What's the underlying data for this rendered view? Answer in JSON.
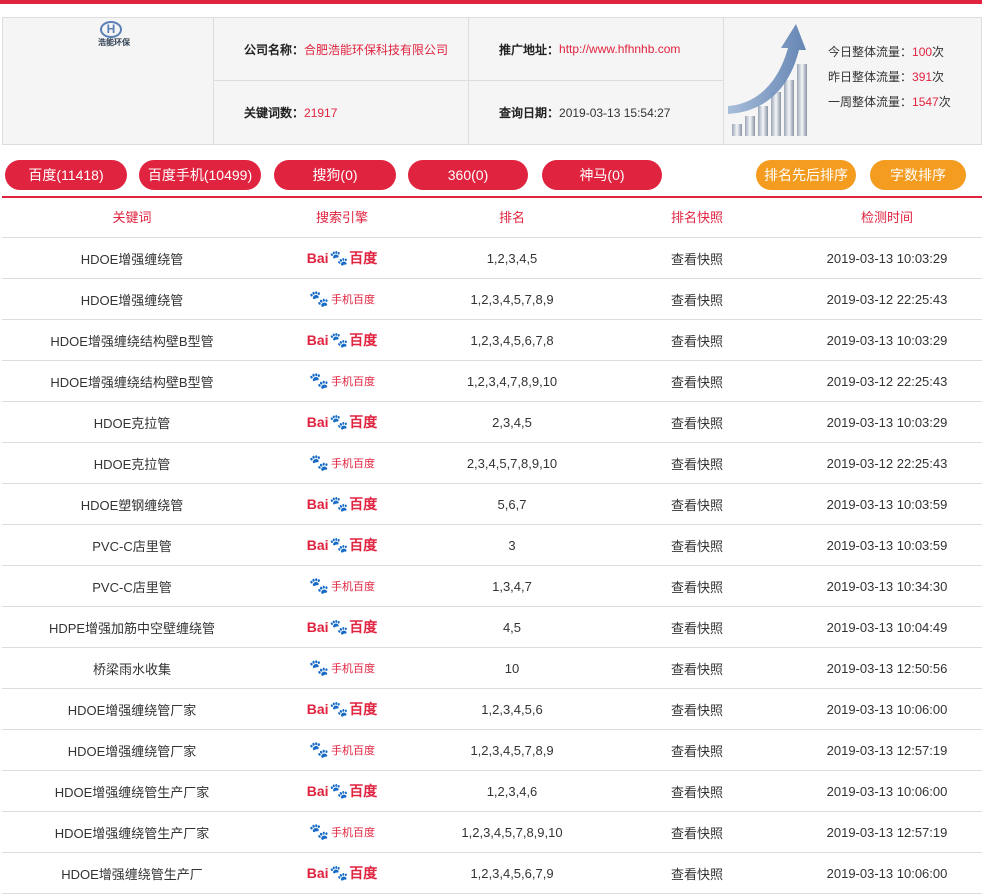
{
  "header": {
    "logo_text": "浩能环保",
    "company_label": "公司名称：",
    "company_value": "合肥浩能环保科技有限公司",
    "url_label": "推广地址：",
    "url_value": "http://www.hfhnhb.com",
    "keywords_label": "关键词数：",
    "keywords_value": "21917",
    "date_label": "查询日期：",
    "date_value": "2019-03-13 15:54:27",
    "traffic": [
      {
        "label": "今日整体流量：",
        "value": "100",
        "unit": "次"
      },
      {
        "label": "昨日整体流量：",
        "value": "391",
        "unit": "次"
      },
      {
        "label": "一周整体流量：",
        "value": "1547",
        "unit": "次"
      }
    ]
  },
  "tabs": {
    "baidu": "百度(11418)",
    "baidu_mobile": "百度手机(10499)",
    "sogou": "搜狗(0)",
    "s360": "360(0)",
    "shenma": "神马(0)",
    "sort_rank": "排名先后排序",
    "sort_chars": "字数排序"
  },
  "table": {
    "headers": [
      "关键词",
      "搜索引擎",
      "排名",
      "排名快照",
      "检测时间"
    ],
    "engine_labels": {
      "baidu_bai": "Bai",
      "baidu_du": "百度",
      "mobile": "手机百度"
    },
    "rows": [
      {
        "keyword": "HDOE增强缠绕管",
        "engine": "baidu",
        "rank": "1,2,3,4,5",
        "snapshot": "查看快照",
        "time": "2019-03-13 10:03:29"
      },
      {
        "keyword": "HDOE增强缠绕管",
        "engine": "mobile",
        "rank": "1,2,3,4,5,7,8,9",
        "snapshot": "查看快照",
        "time": "2019-03-12 22:25:43"
      },
      {
        "keyword": "HDOE增强缠绕结构壁B型管",
        "engine": "baidu",
        "rank": "1,2,3,4,5,6,7,8",
        "snapshot": "查看快照",
        "time": "2019-03-13 10:03:29"
      },
      {
        "keyword": "HDOE增强缠绕结构壁B型管",
        "engine": "mobile",
        "rank": "1,2,3,4,7,8,9,10",
        "snapshot": "查看快照",
        "time": "2019-03-12 22:25:43"
      },
      {
        "keyword": "HDOE克拉管",
        "engine": "baidu",
        "rank": "2,3,4,5",
        "snapshot": "查看快照",
        "time": "2019-03-13 10:03:29"
      },
      {
        "keyword": "HDOE克拉管",
        "engine": "mobile",
        "rank": "2,3,4,5,7,8,9,10",
        "snapshot": "查看快照",
        "time": "2019-03-12 22:25:43"
      },
      {
        "keyword": "HDOE塑钢缠绕管",
        "engine": "baidu",
        "rank": "5,6,7",
        "snapshot": "查看快照",
        "time": "2019-03-13 10:03:59"
      },
      {
        "keyword": "PVC-C店里管",
        "engine": "baidu",
        "rank": "3",
        "snapshot": "查看快照",
        "time": "2019-03-13 10:03:59"
      },
      {
        "keyword": "PVC-C店里管",
        "engine": "mobile",
        "rank": "1,3,4,7",
        "snapshot": "查看快照",
        "time": "2019-03-13 10:34:30"
      },
      {
        "keyword": "HDPE增强加筋中空壁缠绕管",
        "engine": "baidu",
        "rank": "4,5",
        "snapshot": "查看快照",
        "time": "2019-03-13 10:04:49"
      },
      {
        "keyword": "桥梁雨水收集",
        "engine": "mobile",
        "rank": "10",
        "snapshot": "查看快照",
        "time": "2019-03-13 12:50:56"
      },
      {
        "keyword": "HDOE增强缠绕管厂家",
        "engine": "baidu",
        "rank": "1,2,3,4,5,6",
        "snapshot": "查看快照",
        "time": "2019-03-13 10:06:00"
      },
      {
        "keyword": "HDOE增强缠绕管厂家",
        "engine": "mobile",
        "rank": "1,2,3,4,5,7,8,9",
        "snapshot": "查看快照",
        "time": "2019-03-13 12:57:19"
      },
      {
        "keyword": "HDOE增强缠绕管生产厂家",
        "engine": "baidu",
        "rank": "1,2,3,4,6",
        "snapshot": "查看快照",
        "time": "2019-03-13 10:06:00"
      },
      {
        "keyword": "HDOE增强缠绕管生产厂家",
        "engine": "mobile",
        "rank": "1,2,3,4,5,7,8,9,10",
        "snapshot": "查看快照",
        "time": "2019-03-13 12:57:19"
      },
      {
        "keyword": "HDOE增强缠绕管生产厂",
        "engine": "baidu",
        "rank": "1,2,3,4,5,6,7,9",
        "snapshot": "查看快照",
        "time": "2019-03-13 10:06:00"
      }
    ]
  },
  "colors": {
    "accent": "#e0233f",
    "orange": "#f39c1f",
    "baidu_blue": "#2d64d8"
  }
}
